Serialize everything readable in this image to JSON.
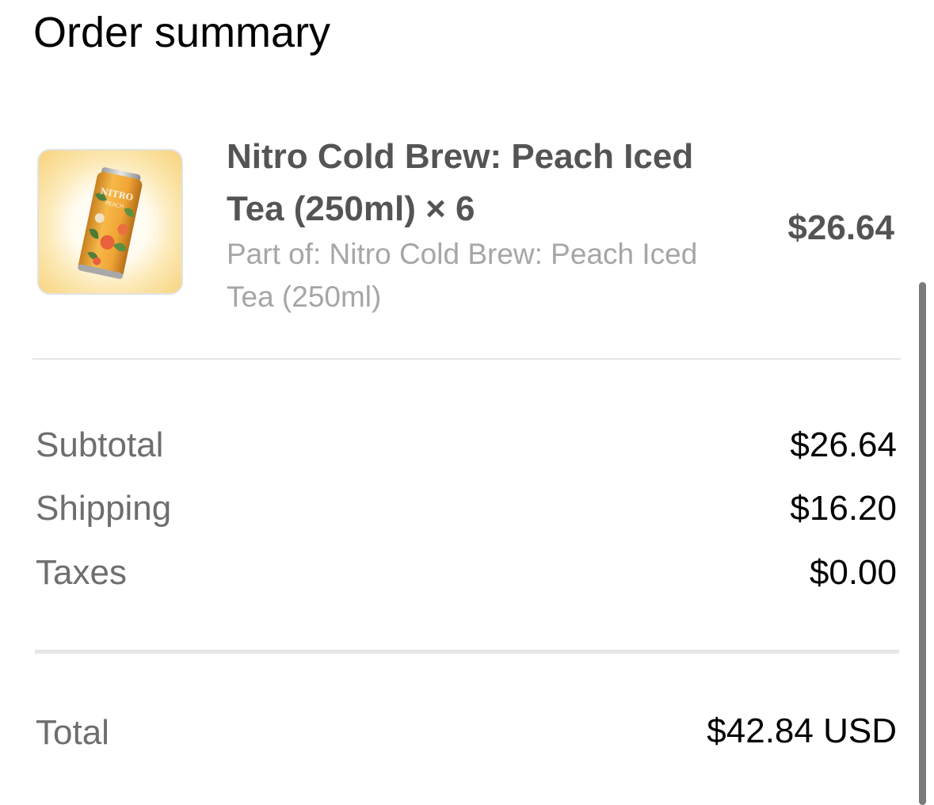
{
  "page": {
    "title": "Order summary"
  },
  "item": {
    "name": "Nitro Cold Brew: Peach Iced Tea (250ml) × 6",
    "subtitle": "Part of: Nitro Cold Brew: Peach Iced Tea (250ml)",
    "price": "$26.64",
    "image_icon": "beverage-can-image",
    "can_label_text": "NITRO",
    "can_label_sub": "PEACH"
  },
  "summary": {
    "subtotal_label": "Subtotal",
    "subtotal_value": "$26.64",
    "shipping_label": "Shipping",
    "shipping_value": "$16.20",
    "taxes_label": "Taxes",
    "taxes_value": "$0.00",
    "total_label": "Total",
    "total_value": "$42.84 USD"
  },
  "colors": {
    "text_primary": "#000000",
    "text_item": "#545454",
    "text_muted": "#a6a6a6",
    "text_label": "#6e6e6e",
    "divider": "#e6e6e6",
    "thumb_border": "#e3e3e3",
    "can_body": "#f2a93b"
  }
}
